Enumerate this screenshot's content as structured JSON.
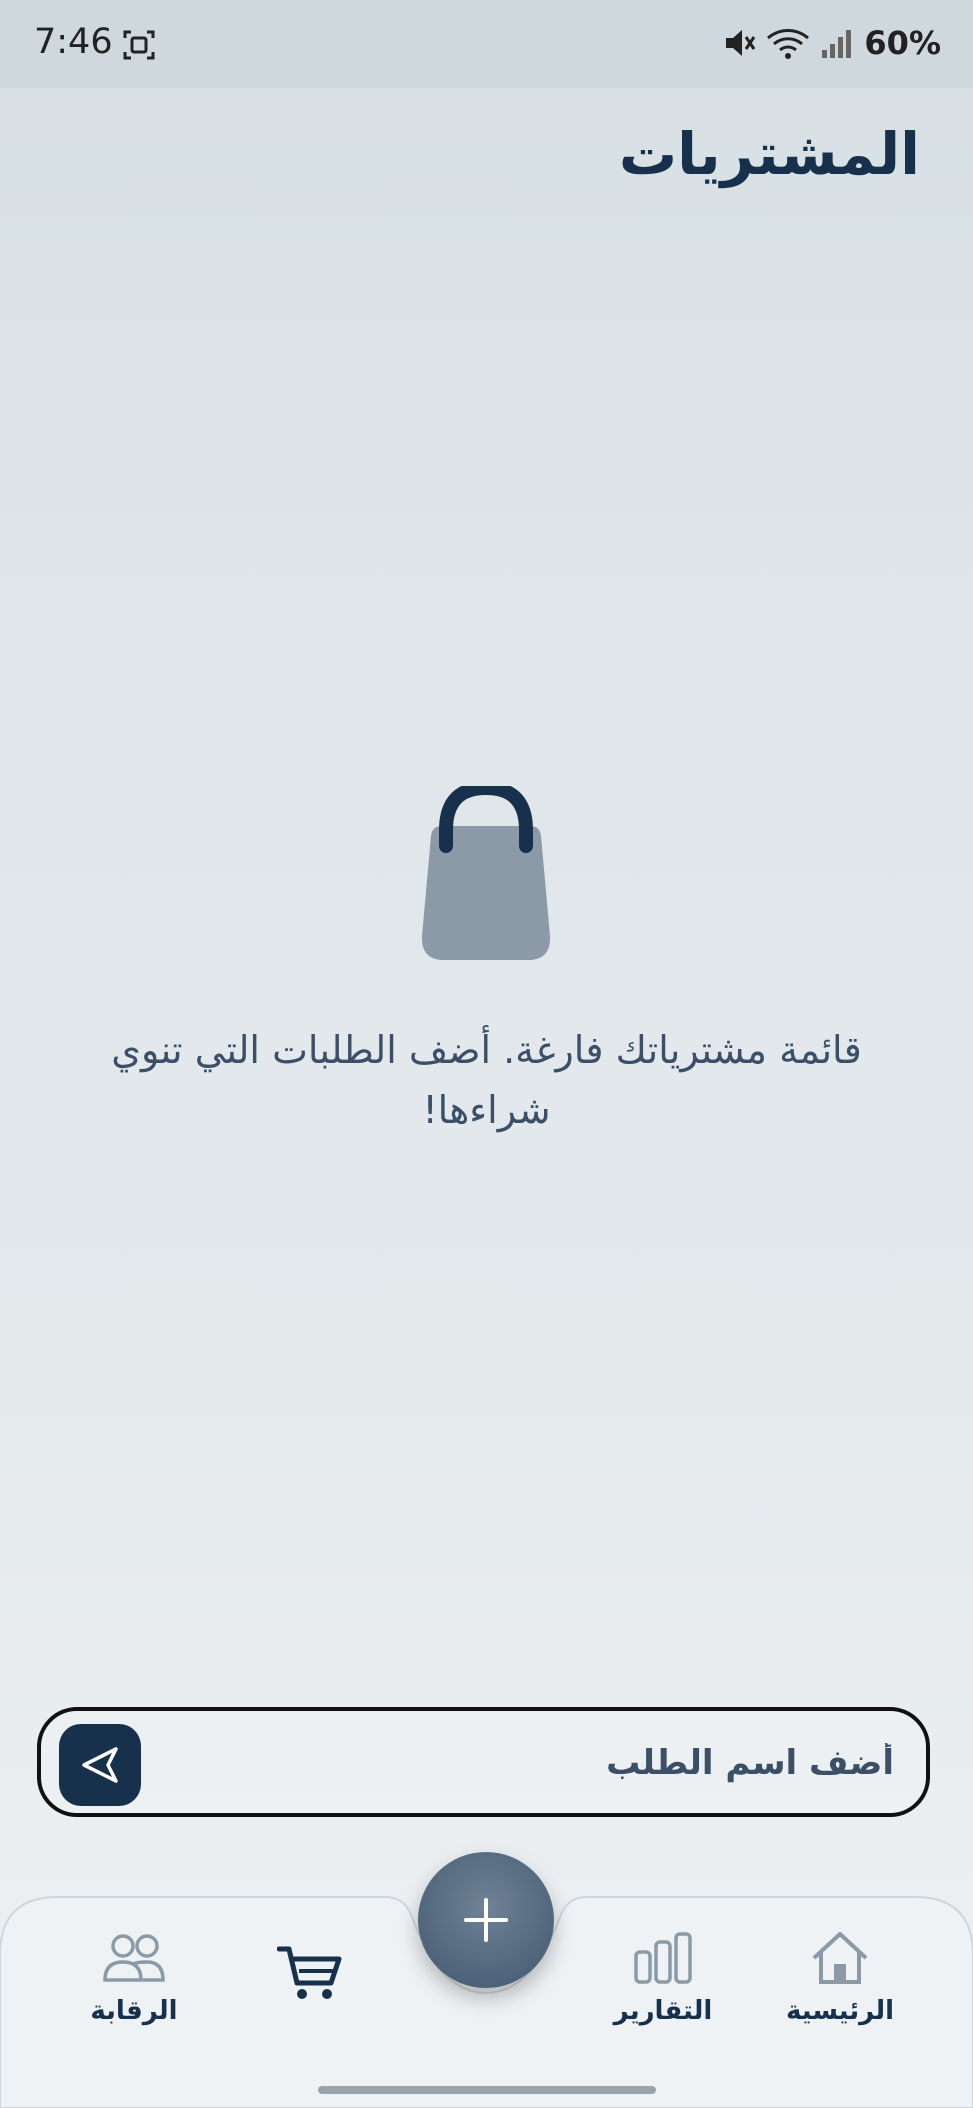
{
  "status_bar": {
    "time": "7:46",
    "battery": "60%",
    "icons": [
      "screenshot-icon",
      "mute-icon",
      "wifi-icon",
      "signal-icon"
    ]
  },
  "header": {
    "title": "المشتريات"
  },
  "empty_state": {
    "icon": "shopping-bag-icon",
    "message": "قائمة مشترياتك فارغة. أضف الطلبات التي تنوي شراءها!"
  },
  "composer": {
    "placeholder": "أضف اسم الطلب",
    "send_icon": "send-icon"
  },
  "bottom_nav": {
    "items": [
      {
        "label": "الرئيسية",
        "icon": "home-icon"
      },
      {
        "label": "التقارير",
        "icon": "bar-chart-icon"
      },
      {
        "label": "",
        "icon": "cart-icon"
      },
      {
        "label": "الرقابة",
        "icon": "users-icon"
      }
    ],
    "fab_icon": "plus-icon"
  },
  "colors": {
    "primary": "#17314d",
    "fab": "#4f647a",
    "muted_icon": "#8c99a6"
  }
}
